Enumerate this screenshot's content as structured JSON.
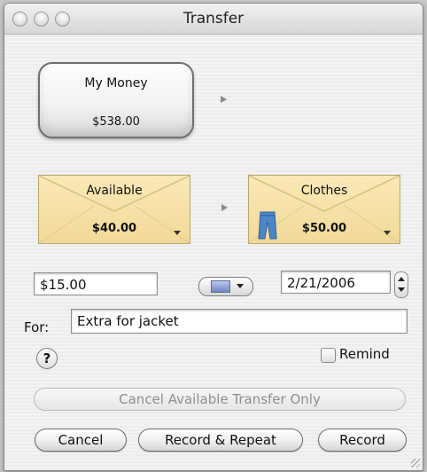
{
  "window": {
    "title": "Transfer"
  },
  "source_account": {
    "name": "My Money",
    "amount": "$538.00"
  },
  "from_envelope": {
    "name": "Available",
    "amount": "$40.00"
  },
  "to_envelope": {
    "name": "Clothes",
    "amount": "$50.00",
    "icon": "jeans-icon"
  },
  "amount_field": {
    "value": "$15.00"
  },
  "date_field": {
    "value": "2/21/2006"
  },
  "for_field": {
    "label": "For:",
    "value": "Extra for jacket"
  },
  "remind": {
    "label": "Remind",
    "checked": false
  },
  "help": {
    "label": "?"
  },
  "buttons": {
    "cancel_transfer": "Cancel Available Transfer Only",
    "cancel": "Cancel",
    "record_repeat": "Record & Repeat",
    "record": "Record"
  },
  "colors": {
    "envelope": "#f1d998",
    "accent_icon": "#6f87c2"
  }
}
